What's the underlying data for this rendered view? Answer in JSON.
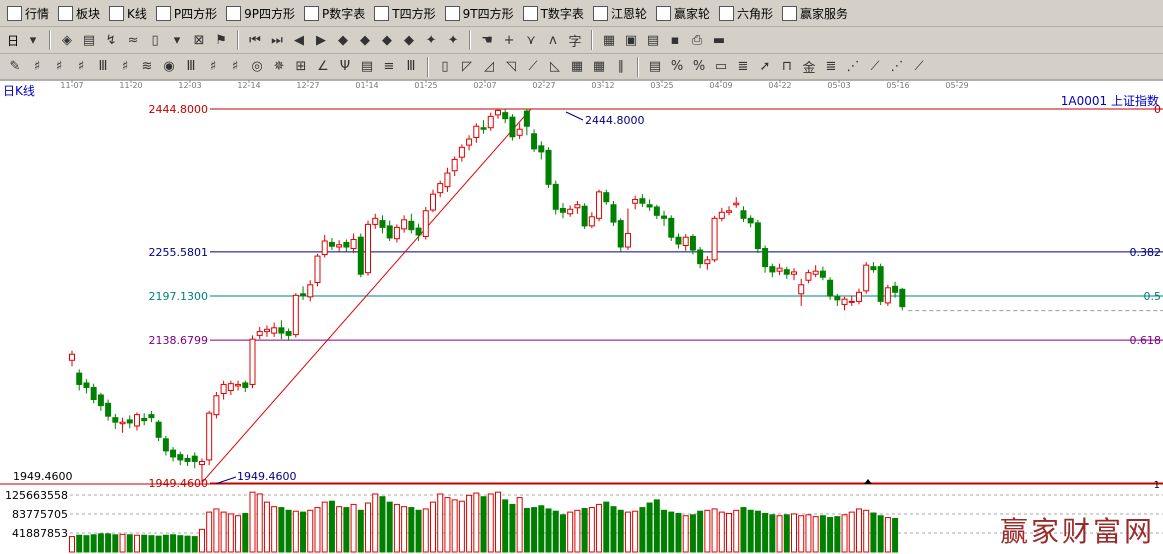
{
  "menu": [
    {
      "icon": "quote-grid-icon",
      "label": "行情"
    },
    {
      "icon": "sector-blocks-icon",
      "label": "板块"
    },
    {
      "icon": "kline-icon",
      "label": "K线"
    },
    {
      "icon": "ps-badge-icon",
      "label": "P四方形"
    },
    {
      "icon": "p9-badge-icon",
      "label": "9P四方形"
    },
    {
      "icon": "pn-badge-icon",
      "label": "P数字表"
    },
    {
      "icon": "ts-badge-icon",
      "label": "T四方形"
    },
    {
      "icon": "t9-badge-icon",
      "label": "9T四方形"
    },
    {
      "icon": "tn-badge-icon",
      "label": "T数字表"
    },
    {
      "icon": "gann-wheel-icon",
      "label": "江恩轮"
    },
    {
      "icon": "yingjia-wheel-icon",
      "label": "赢家轮"
    },
    {
      "icon": "hexagon-icon",
      "label": "六角形"
    },
    {
      "icon": "dollar-icon",
      "label": "赢家服务"
    }
  ],
  "period_selector": "日",
  "chart_data": {
    "type": "candlestick",
    "title": "日K线",
    "symbol": "1A0001  上证指数",
    "x_tick_labels": [
      "11-07",
      "11-20",
      "12-03",
      "12-14",
      "12-27",
      "01-14",
      "01-25",
      "02-07",
      "02-27",
      "03-12",
      "03-25",
      "04-09",
      "04-22",
      "05-03",
      "05-16",
      "05-29"
    ],
    "fib_levels": [
      {
        "value": 2444.8,
        "label": "2444.8000",
        "ratio": "0",
        "color": "#c00000"
      },
      {
        "value": 2255.5801,
        "label": "2255.5801",
        "ratio": "0.382",
        "color": "#000080"
      },
      {
        "value": 2197.13,
        "label": "2197.1300",
        "ratio": "0.5",
        "color": "#008080"
      },
      {
        "value": 2138.6799,
        "label": "2138.6799",
        "ratio": "0.618",
        "color": "#800080"
      },
      {
        "value": 1949.46,
        "label": "1949.4600",
        "ratio": "",
        "color": "#c00000"
      }
    ],
    "high_annotation": "2444.8000",
    "low_annotation": "1949.4600",
    "low_axis_label": "1949.4600",
    "volume_axis_label": "1",
    "volume_ticks": [
      "125663558",
      "83775705",
      "41887853"
    ],
    "volume_max": 150000000,
    "candles": [
      [
        2112,
        2120,
        2125,
        2104
      ],
      [
        2095,
        2080,
        2100,
        2072
      ],
      [
        2082,
        2076,
        2087,
        2068
      ],
      [
        2076,
        2060,
        2081,
        2055
      ],
      [
        2066,
        2052,
        2069,
        2045
      ],
      [
        2055,
        2038,
        2060,
        2032
      ],
      [
        2036,
        2030,
        2041,
        2021
      ],
      [
        2028,
        2030,
        2036,
        2016
      ],
      [
        2033,
        2029,
        2039,
        2022
      ],
      [
        2025,
        2040,
        2043,
        2019
      ],
      [
        2035,
        2032,
        2042,
        2026
      ],
      [
        2040,
        2036,
        2045,
        2030
      ],
      [
        2030,
        2010,
        2033,
        2005
      ],
      [
        2008,
        1992,
        2012,
        1986
      ],
      [
        1993,
        1984,
        1997,
        1978
      ],
      [
        1987,
        1980,
        1991,
        1973
      ],
      [
        1982,
        1978,
        1987,
        1972
      ],
      [
        1985,
        1978,
        1990,
        1969
      ],
      [
        1974,
        1978,
        1982,
        1950
      ],
      [
        1980,
        2042,
        2045,
        1973
      ],
      [
        2040,
        2065,
        2070,
        2035
      ],
      [
        2068,
        2080,
        2085,
        2060
      ],
      [
        2072,
        2081,
        2085,
        2066
      ],
      [
        2078,
        2080,
        2085,
        2072
      ],
      [
        2082,
        2076,
        2085,
        2070
      ],
      [
        2080,
        2140,
        2145,
        2075
      ],
      [
        2145,
        2150,
        2156,
        2140
      ],
      [
        2150,
        2153,
        2158,
        2143
      ],
      [
        2148,
        2155,
        2162,
        2143
      ],
      [
        2155,
        2148,
        2165,
        2140
      ],
      [
        2150,
        2145,
        2154,
        2138
      ],
      [
        2146,
        2198,
        2201,
        2142
      ],
      [
        2200,
        2198,
        2210,
        2192
      ],
      [
        2196,
        2212,
        2218,
        2190
      ],
      [
        2215,
        2250,
        2253,
        2210
      ],
      [
        2252,
        2270,
        2278,
        2248
      ],
      [
        2268,
        2263,
        2274,
        2258
      ],
      [
        2262,
        2265,
        2271,
        2255
      ],
      [
        2268,
        2262,
        2272,
        2256
      ],
      [
        2260,
        2272,
        2280,
        2254
      ],
      [
        2275,
        2226,
        2280,
        2222
      ],
      [
        2228,
        2292,
        2297,
        2224
      ],
      [
        2292,
        2300,
        2306,
        2286
      ],
      [
        2297,
        2288,
        2304,
        2280
      ],
      [
        2290,
        2274,
        2297,
        2270
      ],
      [
        2273,
        2288,
        2292,
        2268
      ],
      [
        2286,
        2298,
        2304,
        2281
      ],
      [
        2296,
        2285,
        2306,
        2280
      ],
      [
        2287,
        2278,
        2293,
        2270
      ],
      [
        2276,
        2310,
        2315,
        2272
      ],
      [
        2311,
        2332,
        2338,
        2308
      ],
      [
        2334,
        2346,
        2350,
        2328
      ],
      [
        2342,
        2360,
        2367,
        2335
      ],
      [
        2363,
        2378,
        2382,
        2356
      ],
      [
        2381,
        2394,
        2398,
        2375
      ],
      [
        2397,
        2405,
        2410,
        2390
      ],
      [
        2407,
        2422,
        2426,
        2400
      ],
      [
        2420,
        2418,
        2430,
        2412
      ],
      [
        2420,
        2435,
        2440,
        2416
      ],
      [
        2437,
        2443,
        2445,
        2432
      ],
      [
        2440,
        2432,
        2445,
        2426
      ],
      [
        2434,
        2408,
        2438,
        2403
      ],
      [
        2410,
        2418,
        2426,
        2405
      ],
      [
        2442,
        2422,
        2445,
        2410
      ],
      [
        2412,
        2392,
        2418,
        2388
      ],
      [
        2396,
        2388,
        2402,
        2378
      ],
      [
        2390,
        2345,
        2394,
        2340
      ],
      [
        2345,
        2312,
        2350,
        2305
      ],
      [
        2313,
        2308,
        2320,
        2300
      ],
      [
        2306,
        2312,
        2317,
        2302
      ],
      [
        2314,
        2318,
        2323,
        2306
      ],
      [
        2316,
        2290,
        2320,
        2286
      ],
      [
        2290,
        2302,
        2308,
        2287
      ],
      [
        2300,
        2335,
        2338,
        2296
      ],
      [
        2334,
        2322,
        2338,
        2318
      ],
      [
        2318,
        2295,
        2323,
        2290
      ],
      [
        2297,
        2262,
        2300,
        2255
      ],
      [
        2262,
        2280,
        2313,
        2258
      ],
      [
        2320,
        2325,
        2330,
        2312
      ],
      [
        2326,
        2320,
        2332,
        2315
      ],
      [
        2318,
        2315,
        2325,
        2310
      ],
      [
        2315,
        2304,
        2318,
        2299
      ],
      [
        2303,
        2300,
        2310,
        2290
      ],
      [
        2300,
        2275,
        2304,
        2270
      ],
      [
        2275,
        2266,
        2280,
        2260
      ],
      [
        2264,
        2275,
        2279,
        2257
      ],
      [
        2276,
        2258,
        2279,
        2252
      ],
      [
        2258,
        2240,
        2262,
        2234
      ],
      [
        2240,
        2245,
        2250,
        2232
      ],
      [
        2245,
        2300,
        2303,
        2242
      ],
      [
        2300,
        2308,
        2314,
        2296
      ],
      [
        2308,
        2310,
        2316,
        2304
      ],
      [
        2318,
        2320,
        2328,
        2314
      ],
      [
        2310,
        2300,
        2316,
        2295
      ],
      [
        2300,
        2294,
        2304,
        2288
      ],
      [
        2294,
        2260,
        2298,
        2254
      ],
      [
        2260,
        2236,
        2264,
        2228
      ],
      [
        2236,
        2229,
        2240,
        2222
      ],
      [
        2230,
        2234,
        2240,
        2225
      ],
      [
        2232,
        2226,
        2236,
        2220
      ],
      [
        2226,
        2229,
        2234,
        2218
      ],
      [
        2200,
        2212,
        2220,
        2184
      ],
      [
        2218,
        2228,
        2232,
        2214
      ],
      [
        2226,
        2230,
        2238,
        2222
      ],
      [
        2230,
        2222,
        2236,
        2218
      ],
      [
        2218,
        2197,
        2222,
        2192
      ],
      [
        2196,
        2192,
        2200,
        2184
      ],
      [
        2186,
        2193,
        2196,
        2178
      ],
      [
        2190,
        2190,
        2198,
        2184
      ],
      [
        2190,
        2202,
        2207,
        2186
      ],
      [
        2204,
        2238,
        2242,
        2200
      ],
      [
        2236,
        2232,
        2242,
        2228
      ],
      [
        2236,
        2190,
        2240,
        2185
      ],
      [
        2188,
        2208,
        2212,
        2184
      ],
      [
        2210,
        2202,
        2216,
        2195
      ],
      [
        2206,
        2183,
        2208,
        2178
      ]
    ],
    "volumes": [
      34,
      37,
      36,
      38,
      40,
      40,
      38,
      39,
      38,
      37,
      37,
      36,
      35,
      37,
      38,
      36,
      35,
      34,
      50,
      88,
      95,
      88,
      84,
      80,
      85,
      132,
      128,
      110,
      100,
      98,
      92,
      90,
      88,
      92,
      98,
      110,
      112,
      100,
      98,
      105,
      92,
      108,
      128,
      122,
      110,
      105,
      100,
      98,
      92,
      95,
      110,
      128,
      120,
      115,
      112,
      125,
      130,
      122,
      128,
      132,
      115,
      105,
      120,
      96,
      98,
      102,
      95,
      90,
      82,
      88,
      92,
      96,
      98,
      105,
      110,
      100,
      92,
      88,
      90,
      98,
      108,
      115,
      92,
      88,
      85,
      80,
      82,
      90,
      92,
      95,
      88,
      85,
      92,
      98,
      92,
      90,
      85,
      82,
      80,
      82,
      84,
      80,
      82,
      78,
      80,
      76,
      78,
      82,
      88,
      95,
      92,
      86,
      80,
      76,
      74
    ]
  }
}
